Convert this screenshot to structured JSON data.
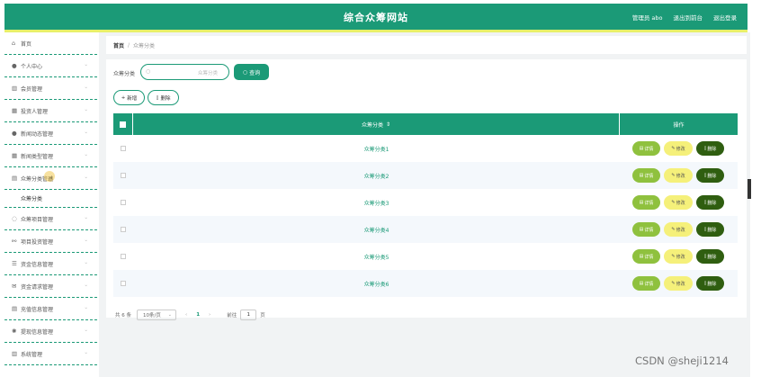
{
  "header": {
    "title": "综合众筹网站",
    "links": [
      "管理员 abo",
      "退出到前台",
      "退出登录"
    ]
  },
  "sidebar": {
    "items": [
      {
        "label": "首页",
        "icon": "home-icon",
        "glyph": "⌂",
        "chevron": false
      },
      {
        "label": "个人中心",
        "icon": "user-icon",
        "glyph": "●",
        "chevron": true
      },
      {
        "label": "会员管理",
        "icon": "chart-icon",
        "glyph": "▥",
        "chevron": true
      },
      {
        "label": "投资人管理",
        "icon": "table-icon",
        "glyph": "▦",
        "chevron": true
      },
      {
        "label": "新闻动态管理",
        "icon": "person-icon",
        "glyph": "●",
        "chevron": true
      },
      {
        "label": "新闻类型管理",
        "icon": "grid-icon",
        "glyph": "▦",
        "chevron": true
      },
      {
        "label": "众筹分类管理",
        "icon": "folder-icon",
        "glyph": "▤",
        "chevron": true
      }
    ],
    "subitem": "众筹分类",
    "items_after": [
      {
        "label": "众筹项目管理",
        "icon": "circle-icon",
        "glyph": "◌",
        "chevron": true
      },
      {
        "label": "项目投资管理",
        "icon": "invest-icon",
        "glyph": "⚯",
        "chevron": true
      },
      {
        "label": "资金信息管理",
        "icon": "list-icon",
        "glyph": "☰",
        "chevron": true
      },
      {
        "label": "资金请求管理",
        "icon": "mail-icon",
        "glyph": "✉",
        "chevron": true
      },
      {
        "label": "充值信息管理",
        "icon": "bank-icon",
        "glyph": "▤",
        "chevron": true
      },
      {
        "label": "提现信息管理",
        "icon": "gear-icon",
        "glyph": "✺",
        "chevron": true
      },
      {
        "label": "系统管理",
        "icon": "bar-chart-icon",
        "glyph": "▥",
        "chevron": true
      }
    ]
  },
  "breadcrumb": {
    "home": "首页",
    "sep": "/",
    "current": "众筹分类"
  },
  "search": {
    "label": "众筹分类",
    "placeholder": "众筹分类",
    "button": "查询"
  },
  "actions": {
    "add": "新增",
    "delete": "删除"
  },
  "table": {
    "col_name": "众筹分类",
    "col_ops": "操作",
    "rows": [
      "众筹分类1",
      "众筹分类2",
      "众筹分类3",
      "众筹分类4",
      "众筹分类5",
      "众筹分类6"
    ],
    "ops": {
      "detail": "详情",
      "edit": "修改",
      "delete": "删除"
    }
  },
  "pager": {
    "total": "共 6 条",
    "page_size": "10条/页",
    "current_page": "1",
    "goto_label": "前往",
    "goto_value": "1",
    "goto_unit": "页"
  },
  "watermark": "CSDN @sheji1214",
  "colors": {
    "primary": "#1b9a77",
    "accent": "#e8f06a",
    "detail": "#8fc13e",
    "edit": "#f5f07a",
    "delete": "#2f5e10"
  }
}
